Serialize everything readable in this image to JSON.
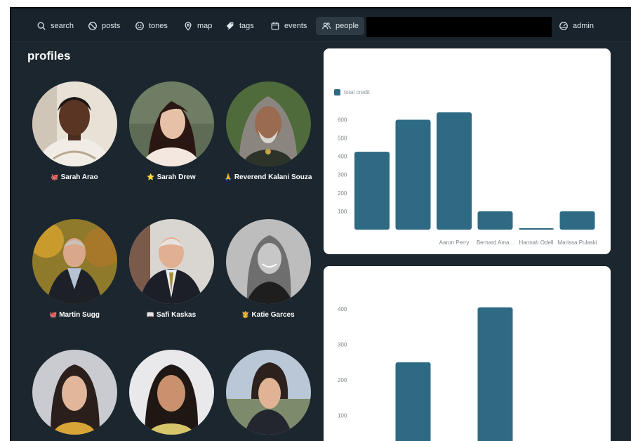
{
  "nav": {
    "items": [
      {
        "key": "search",
        "label": "search",
        "icon": "search-icon"
      },
      {
        "key": "posts",
        "label": "posts",
        "icon": "no-entry-icon"
      },
      {
        "key": "tones",
        "label": "tones",
        "icon": "smiley-icon"
      },
      {
        "key": "map",
        "label": "map",
        "icon": "map-pin-icon"
      },
      {
        "key": "tags",
        "label": "tags",
        "icon": "tags-icon"
      },
      {
        "key": "events",
        "label": "events",
        "icon": "calendar-icon"
      },
      {
        "key": "people",
        "label": "people",
        "icon": "people-icon"
      }
    ],
    "active": "people",
    "search_value": "",
    "admin_label": "admin",
    "admin_icon": "dashboard-gauge-icon"
  },
  "profiles": {
    "title": "profiles",
    "people": [
      {
        "emoji": "🐙",
        "name": "Sarah Arao"
      },
      {
        "emoji": "⭐",
        "name": "Sarah Drew"
      },
      {
        "emoji": "🙏",
        "name": "Reverend Kalani Souza"
      },
      {
        "emoji": "🐙",
        "name": "Martin Sugg"
      },
      {
        "emoji": "📖",
        "name": "Safi Kaskas"
      },
      {
        "emoji": "👸",
        "name": "Katie Garces"
      },
      {
        "emoji": "",
        "name": ""
      },
      {
        "emoji": "",
        "name": ""
      },
      {
        "emoji": "",
        "name": ""
      }
    ]
  },
  "colors": {
    "background": "#1b262e",
    "bar": "#2e6a83",
    "card": "#ffffff"
  },
  "chart_data": [
    {
      "type": "bar",
      "legend": [
        "total credit"
      ],
      "categories": [
        "",
        "",
        "Aaron Perry",
        "Bernard Ama...",
        "Hannah Odell",
        "Marissa Pulaski"
      ],
      "values": [
        425,
        600,
        640,
        100,
        8,
        100
      ],
      "yticks": [
        100,
        200,
        300,
        400,
        500,
        600
      ],
      "ylim": [
        0,
        690
      ]
    },
    {
      "type": "bar",
      "categories": [
        "",
        "",
        "",
        "",
        "",
        ""
      ],
      "values": [
        0,
        250,
        0,
        405,
        0,
        0
      ],
      "yticks": [
        100,
        200,
        300,
        400
      ],
      "ylim": [
        0,
        430
      ]
    }
  ]
}
